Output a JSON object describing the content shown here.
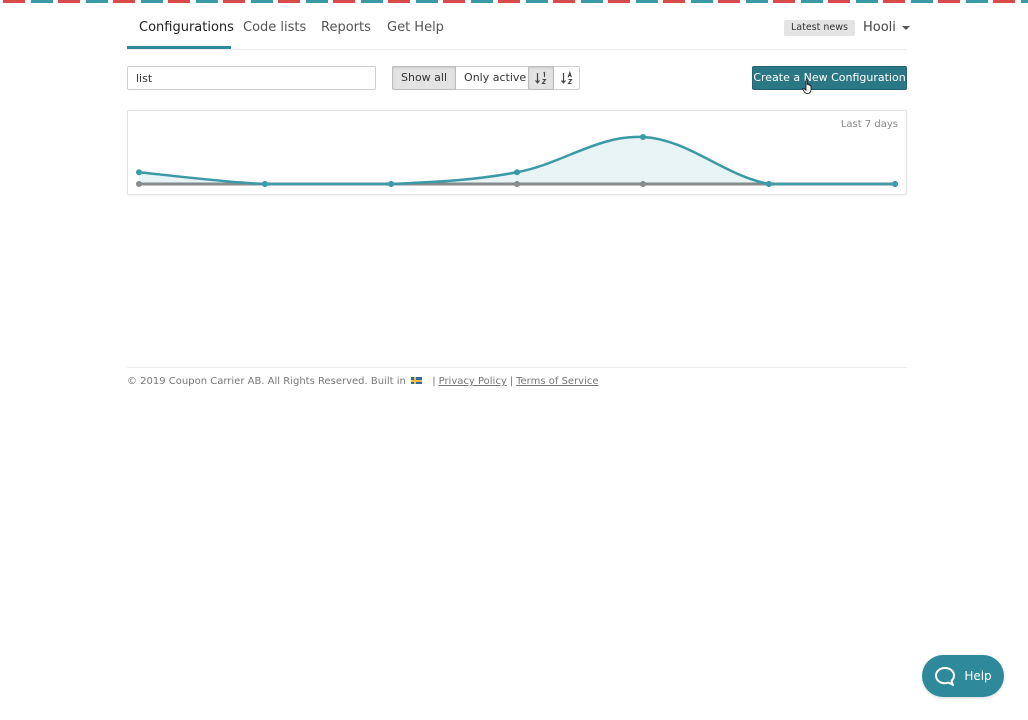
{
  "colors": {
    "accent": "#2e8a9a",
    "primary_button": "#2a7785",
    "stripe_red": "#d94a4a",
    "stripe_teal": "#3a9aa8",
    "series_active": "#3a9aa8",
    "series_baseline": "#8a8a8a"
  },
  "nav": {
    "tabs": [
      {
        "label": "Configurations",
        "active": true
      },
      {
        "label": "Code lists",
        "active": false
      },
      {
        "label": "Reports",
        "active": false
      },
      {
        "label": "Get Help",
        "active": false
      }
    ],
    "news_badge": "Latest news",
    "user": "Hooli"
  },
  "toolbar": {
    "search_value": "list",
    "filters": [
      {
        "label": "Show all",
        "selected": true
      },
      {
        "label": "Only active",
        "selected": false
      }
    ],
    "sort_icons": [
      "sort-numeric-down-icon",
      "sort-alpha-down-icon"
    ],
    "create_label": "Create a New Configuration"
  },
  "chart_data": {
    "type": "line",
    "range_label": "Last 7 days",
    "x": [
      1,
      2,
      3,
      4,
      5,
      6,
      7
    ],
    "ylim": [
      0,
      4
    ],
    "series": [
      {
        "values": [
          1,
          0,
          0,
          1,
          4,
          0,
          0
        ],
        "color": "#3a9aa8",
        "filled": true
      },
      {
        "values": [
          0,
          0,
          0,
          0,
          0,
          0,
          0
        ],
        "color": "#8a8a8a",
        "filled": false
      }
    ]
  },
  "footer": {
    "copyright": "© 2019 Coupon Carrier AB. All Rights Reserved. Built in",
    "separator": "|",
    "privacy_label": "Privacy Policy",
    "terms_label": "Terms of Service"
  },
  "help_widget": {
    "label": "Help",
    "icon": "chat-bubble-icon"
  }
}
